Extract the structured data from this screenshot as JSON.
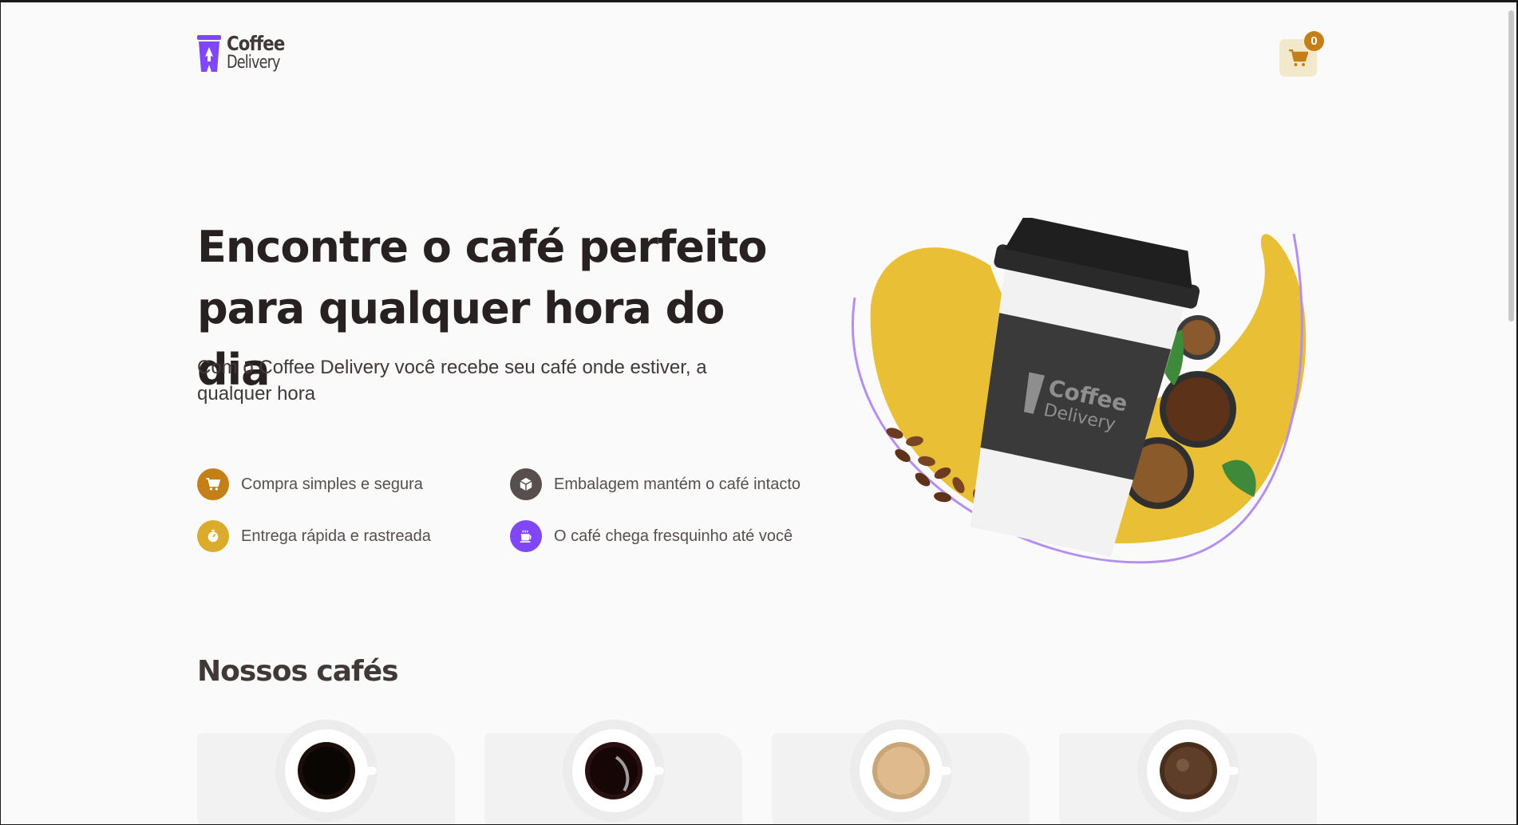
{
  "header": {
    "logo_line1": "Coffee",
    "logo_line2": "Delivery",
    "cart_count": "0"
  },
  "hero": {
    "title_line1": "Encontre o café perfeito",
    "title_line2": "para qualquer hora do dia",
    "subtitle_line1": "Com o Coffee Delivery você recebe seu café onde estiver, a",
    "subtitle_line2": "qualquer hora",
    "features": [
      {
        "label": "Compra simples e segura",
        "icon": "cart-icon",
        "color": "#c47f17"
      },
      {
        "label": "Embalagem mantém o café intacto",
        "icon": "package-icon",
        "color": "#574f4d"
      },
      {
        "label": "Entrega rápida e rastreada",
        "icon": "timer-icon",
        "color": "#dbac2c"
      },
      {
        "label": "O café chega fresquinho até você",
        "icon": "coffee-icon",
        "color": "#8047f8"
      }
    ],
    "cup_logo_line1": "Coffee",
    "cup_logo_line2": "Delivery"
  },
  "catalog": {
    "title": "Nossos cafés"
  },
  "colors": {
    "brand_purple": "#8047f8",
    "brand_yellow": "#dbac2c",
    "brand_yellow_dark": "#c47f17",
    "base_text": "#403937"
  }
}
